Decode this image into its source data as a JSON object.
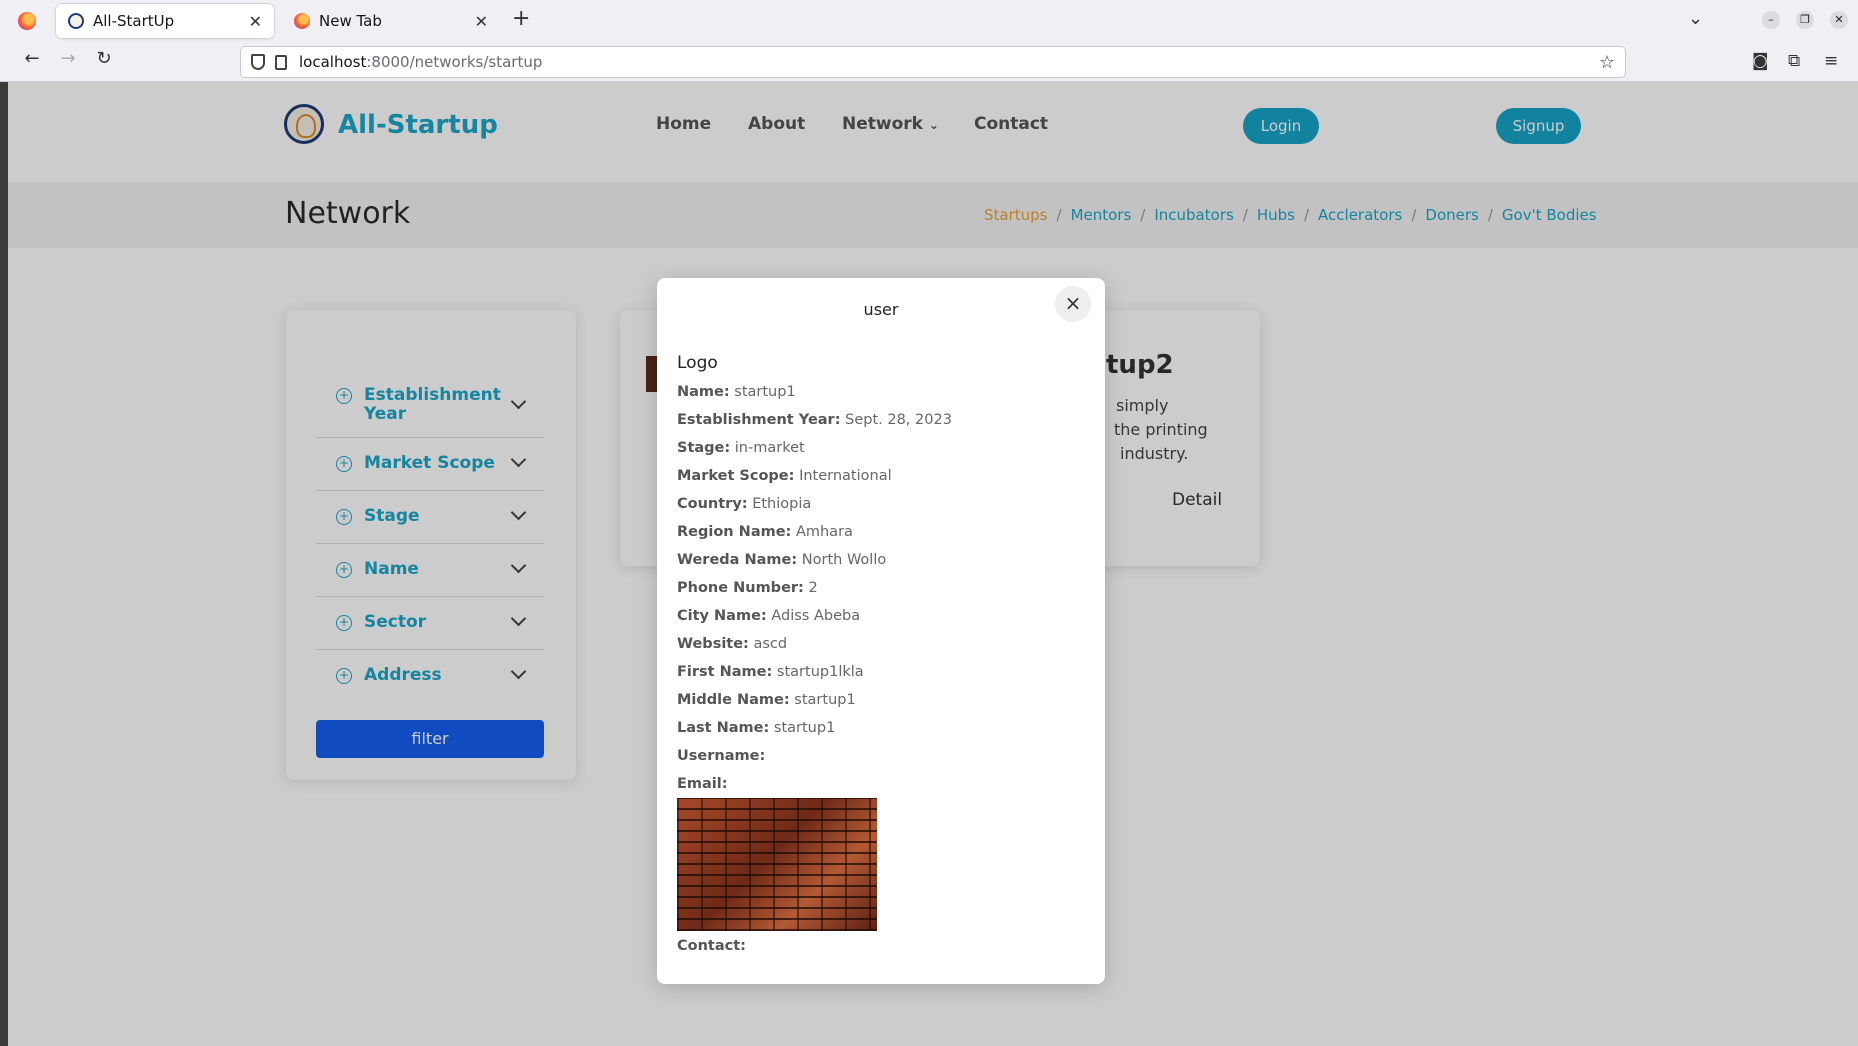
{
  "browser": {
    "tabs": [
      {
        "title": "All-StartUp",
        "active": true
      },
      {
        "title": "New Tab",
        "active": false
      }
    ],
    "url_host": "localhost",
    "url_path": ":8000/networks/startup"
  },
  "header": {
    "brand": "All-Startup",
    "nav": {
      "home": "Home",
      "about": "About",
      "network": "Network",
      "contact": "Contact"
    },
    "login": "Login",
    "signup": "Signup"
  },
  "subheader": {
    "title": "Network",
    "breadcrumbs": [
      "Startups",
      "Mentors",
      "Incubators",
      "Hubs",
      "Acclerators",
      "Doners",
      "Gov't Bodies"
    ]
  },
  "filters": {
    "items": [
      "Establishment Year",
      "Market Scope",
      "Stage",
      "Name",
      "Sector",
      "Address"
    ],
    "button": "filter"
  },
  "cards": {
    "card2_title": "tup2",
    "card2_text": [
      "simply",
      "the printing",
      "industry."
    ],
    "card2_detail": "Detail"
  },
  "modal": {
    "title": "user",
    "logo_heading": "Logo",
    "fields": [
      {
        "label": "Name:",
        "value": "startup1"
      },
      {
        "label": "Establishment Year:",
        "value": "Sept. 28, 2023"
      },
      {
        "label": "Stage:",
        "value": "in-market"
      },
      {
        "label": "Market Scope:",
        "value": "International"
      },
      {
        "label": "Country:",
        "value": "Ethiopia"
      },
      {
        "label": "Region Name:",
        "value": "Amhara"
      },
      {
        "label": "Wereda Name:",
        "value": "North Wollo"
      },
      {
        "label": "Phone Number:",
        "value": "2"
      },
      {
        "label": "City Name:",
        "value": "Adiss Abeba"
      },
      {
        "label": "Website:",
        "value": "ascd"
      },
      {
        "label": "First Name:",
        "value": "startup1lkla"
      },
      {
        "label": "Middle Name:",
        "value": "startup1"
      },
      {
        "label": "Last Name:",
        "value": "startup1"
      },
      {
        "label": "Username:",
        "value": ""
      },
      {
        "label": "Email:",
        "value": ""
      }
    ],
    "contact_label": "Contact:"
  },
  "colors": {
    "accent": "#1ba7c9",
    "filter_button": "#1560f0",
    "breadcrumb_current": "#e8a23a"
  }
}
